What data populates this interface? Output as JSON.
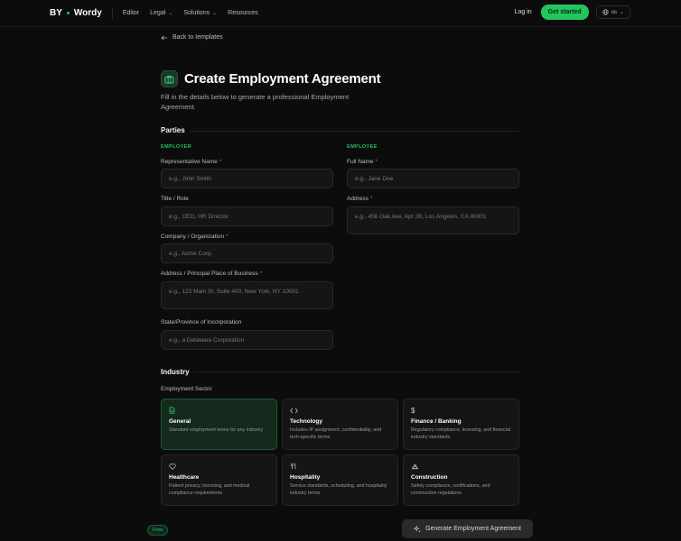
{
  "nav": {
    "brand_left": "BY",
    "brand_right": "Wordy",
    "links": [
      {
        "label": "Editor",
        "has_dropdown": false
      },
      {
        "label": "Legal",
        "has_dropdown": true
      },
      {
        "label": "Solutions",
        "has_dropdown": true
      },
      {
        "label": "Resources",
        "has_dropdown": false
      }
    ],
    "login": "Log in",
    "get_started": "Get started",
    "language": "us"
  },
  "page": {
    "back": "Back to templates",
    "title": "Create Employment Agreement",
    "subtitle": "Fill in the details below to generate a professional Employment Agreement.",
    "icon": "briefcase-icon"
  },
  "parties": {
    "heading": "Parties",
    "employer": {
      "heading": "EMPLOYER",
      "fields": [
        {
          "label": "Representative Name",
          "required": true,
          "placeholder": "e.g., John Smith"
        },
        {
          "label": "Title / Role",
          "required": false,
          "placeholder": "e.g., CEO, HR Director"
        },
        {
          "label": "Company / Organization",
          "required": true,
          "placeholder": "e.g., Acme Corp."
        },
        {
          "label": "Address / Principal Place of Business",
          "required": true,
          "placeholder": "e.g., 123 Main St, Suite 400, New York, NY 10001"
        },
        {
          "label": "State/Province of Incorporation",
          "required": false,
          "placeholder": "e.g., a Delaware Corporation"
        }
      ]
    },
    "employee": {
      "heading": "EMPLOYEE",
      "fields": [
        {
          "label": "Full Name",
          "required": true,
          "placeholder": "e.g., Jane Doe"
        },
        {
          "label": "Address",
          "required": true,
          "placeholder": "e.g., 456 Oak Ave, Apt 2B, Los Angeles, CA 90001"
        }
      ]
    }
  },
  "industry": {
    "heading": "Industry",
    "sector_label": "Employment Sector",
    "cards": [
      {
        "name": "General",
        "desc": "Standard employment terms for any industry",
        "icon": "document-icon",
        "selected": true
      },
      {
        "name": "Technology",
        "desc": "Includes IP assignment, confidentiality, and tech-specific terms",
        "icon": "code-icon",
        "selected": false
      },
      {
        "name": "Finance / Banking",
        "desc": "Regulatory compliance, licensing, and financial industry standards",
        "icon": "dollar-icon",
        "selected": false
      },
      {
        "name": "Healthcare",
        "desc": "Patient privacy, licensing, and medical compliance requirements",
        "icon": "heart-icon",
        "selected": false
      },
      {
        "name": "Hospitality",
        "desc": "Service standards, scheduling, and hospitality industry terms",
        "icon": "utensils-icon",
        "selected": false
      },
      {
        "name": "Construction",
        "desc": "Safety compliance, certifications, and construction regulations",
        "icon": "hardhat-icon",
        "selected": false
      }
    ]
  },
  "footer": {
    "badge": "Free",
    "generate": "Generate Employment Agreement"
  },
  "colors": {
    "accent": "#22c55e",
    "background": "#0c0c0c",
    "required": "#ef4444"
  }
}
